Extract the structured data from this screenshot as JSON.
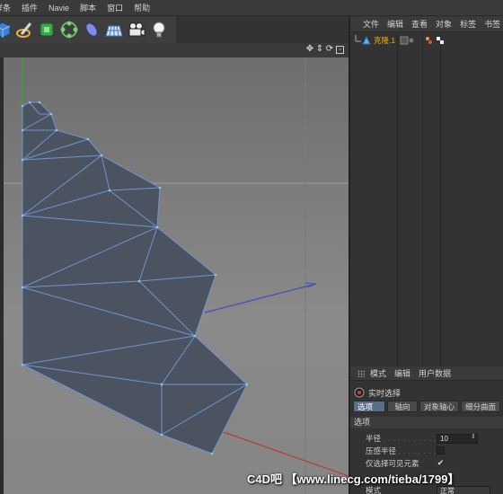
{
  "menubar": {
    "items": [
      {
        "label": "样条"
      },
      {
        "label": "插件"
      },
      {
        "label": "Navie"
      },
      {
        "label": "脚本"
      },
      {
        "label": "窗口"
      },
      {
        "label": "帮助"
      }
    ]
  },
  "toolbar": {
    "tools": [
      {
        "icon": "cube-icon"
      },
      {
        "icon": "pen-icon"
      },
      {
        "icon": "subdivision-icon"
      },
      {
        "icon": "array-icon"
      },
      {
        "icon": "deformer-icon"
      },
      {
        "icon": "floor-icon"
      },
      {
        "icon": "camera-icon"
      },
      {
        "icon": "light-icon"
      }
    ]
  },
  "viewport": {
    "nav_icons": [
      "move-view-icon",
      "dolly-icon",
      "rotate-view-icon",
      "maximize-icon"
    ],
    "colors": {
      "mesh_fill": "#4a5260",
      "wire": "#6a8fc4",
      "axis_y": "#3f9a3f",
      "axis_x": "#b83a3a",
      "axis_z": "#4a4ac0"
    }
  },
  "object_manager": {
    "menu": [
      "文件",
      "编辑",
      "查看",
      "对象",
      "标签",
      "书签"
    ],
    "object": {
      "name": "克隆.1",
      "icon": "cloner-icon"
    }
  },
  "attribute_manager": {
    "menu": [
      "模式",
      "编辑",
      "用户数据"
    ],
    "title": "实时选择",
    "tabs": [
      "选项",
      "轴向",
      "对象轴心",
      "细分曲面"
    ],
    "section": "选项",
    "props": {
      "radius_label": "半径",
      "radius_value": "10",
      "pressure_label": "压感半径",
      "visible_only_label": "仅选择可见元素",
      "visible_only_checked": "✔",
      "mode_label": "模式",
      "mode_value": "正常"
    }
  },
  "watermark": "C4D吧 【www.linecg.com/tieba/1799】"
}
